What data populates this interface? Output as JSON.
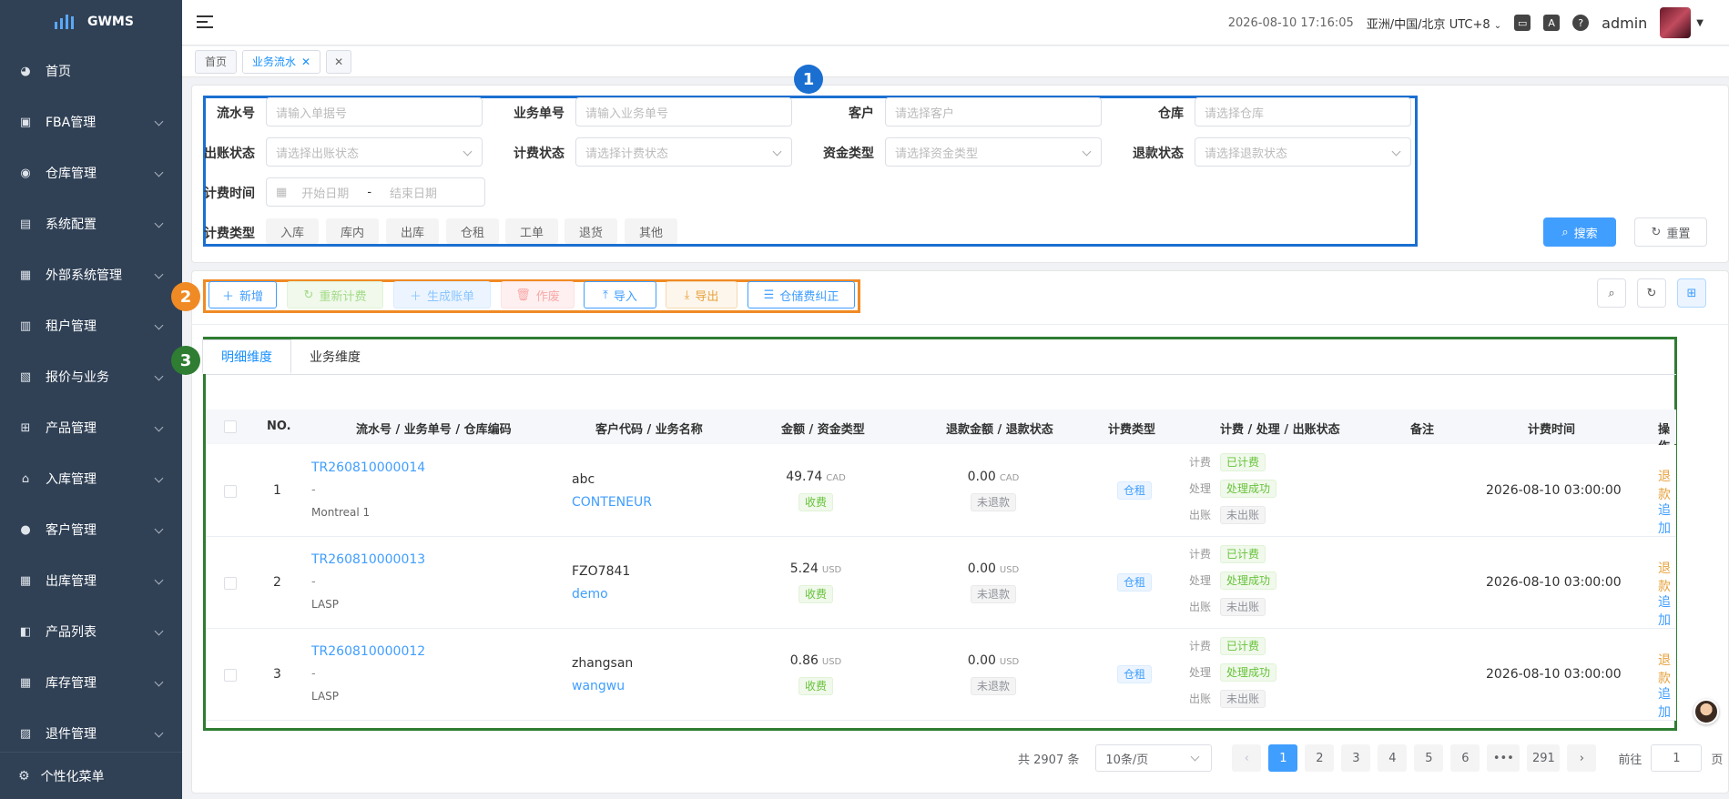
{
  "app": {
    "name": "GWMS"
  },
  "sidebar": {
    "items": [
      {
        "label": "首页",
        "icon": "dashboard-icon",
        "glyph": "◕",
        "expandable": false
      },
      {
        "label": "FBA管理",
        "icon": "fba-icon",
        "glyph": "▣",
        "expandable": true
      },
      {
        "label": "仓库管理",
        "icon": "globe-icon",
        "glyph": "◉",
        "expandable": true
      },
      {
        "label": "系统配置",
        "icon": "config-icon",
        "glyph": "▤",
        "expandable": true
      },
      {
        "label": "外部系统管理",
        "icon": "grid-icon",
        "glyph": "▦",
        "expandable": true
      },
      {
        "label": "租户管理",
        "icon": "bar-chart-icon",
        "glyph": "▥",
        "expandable": true
      },
      {
        "label": "报价与业务",
        "icon": "document-icon",
        "glyph": "▧",
        "expandable": true
      },
      {
        "label": "产品管理",
        "icon": "cart-icon",
        "glyph": "⊞",
        "expandable": true
      },
      {
        "label": "入库管理",
        "icon": "home-icon",
        "glyph": "⌂",
        "expandable": true
      },
      {
        "label": "客户管理",
        "icon": "user-icon",
        "glyph": "●",
        "expandable": true
      },
      {
        "label": "出库管理",
        "icon": "grid-icon",
        "glyph": "▦",
        "expandable": true
      },
      {
        "label": "产品列表",
        "icon": "book-icon",
        "glyph": "◧",
        "expandable": true
      },
      {
        "label": "库存管理",
        "icon": "table-icon",
        "glyph": "▦",
        "expandable": true
      },
      {
        "label": "退件管理",
        "icon": "return-icon",
        "glyph": "▨",
        "expandable": true
      }
    ],
    "bottom": {
      "label": "个性化菜单",
      "icon": "gear-icon",
      "glyph": "⚙"
    }
  },
  "header": {
    "datetime": "2026-08-10 17:16:05",
    "timezone": "亚洲/中国/北京 UTC+8",
    "user": "admin"
  },
  "tabs": [
    {
      "label": "首页",
      "active": false
    },
    {
      "label": "业务流水",
      "active": true
    }
  ],
  "filters": {
    "row1": [
      {
        "label": "流水号",
        "placeholder": "请输入单据号"
      },
      {
        "label": "业务单号",
        "placeholder": "请输入业务单号"
      },
      {
        "label": "客户",
        "placeholder": "请选择客户"
      },
      {
        "label": "仓库",
        "placeholder": "请选择仓库"
      }
    ],
    "row2": [
      {
        "label": "出账状态",
        "placeholder": "请选择出账状态"
      },
      {
        "label": "计费状态",
        "placeholder": "请选择计费状态"
      },
      {
        "label": "资金类型",
        "placeholder": "请选择资金类型"
      },
      {
        "label": "退款状态",
        "placeholder": "请选择退款状态"
      }
    ],
    "billing_time": {
      "label": "计费时间",
      "start": "开始日期",
      "sep": "-",
      "end": "结束日期"
    },
    "billing_type": {
      "label": "计费类型",
      "options": [
        "入库",
        "库内",
        "出库",
        "仓租",
        "工单",
        "退货",
        "其他"
      ]
    },
    "search_label": "搜索",
    "reset_label": "重置"
  },
  "toolbar": {
    "add": "新增",
    "recalc": "重新计费",
    "gen_bill": "生成账单",
    "void": "作废",
    "import": "导入",
    "export": "导出",
    "storage_fix": "仓储费纠正"
  },
  "badges": [
    "1",
    "2",
    "3"
  ],
  "dimension_tabs": [
    {
      "label": "明细维度",
      "active": true
    },
    {
      "label": "业务维度",
      "active": false
    }
  ],
  "table": {
    "columns": [
      "NO.",
      "流水号 / 业务单号 / 仓库编码",
      "客户代码 / 业务名称",
      "金额 / 资金类型",
      "退款金额 / 退款状态",
      "计费类型",
      "计费 / 处理 / 出账状态",
      "备注",
      "计费时间",
      "操作"
    ],
    "rows": [
      {
        "no": "1",
        "flow_no": "TR260810000014",
        "biz_no": "-",
        "warehouse": "Montreal 1",
        "customer": "abc",
        "biz_name": "CONTENEUR",
        "amount": "49.74",
        "currency": "CAD",
        "fund_type": "收费",
        "refund": "0.00",
        "refund_currency": "CAD",
        "refund_status": "未退款",
        "billing_type": "仓租",
        "status_labels": [
          "计费",
          "处理",
          "出账"
        ],
        "statuses": [
          "已计费",
          "处理成功",
          "未出账"
        ],
        "time": "2026-08-10 03:00:00",
        "actions": [
          "退款",
          "追加"
        ]
      },
      {
        "no": "2",
        "flow_no": "TR260810000013",
        "biz_no": "-",
        "warehouse": "LASP",
        "customer": "FZO7841",
        "biz_name": "demo",
        "amount": "5.24",
        "currency": "USD",
        "fund_type": "收费",
        "refund": "0.00",
        "refund_currency": "USD",
        "refund_status": "未退款",
        "billing_type": "仓租",
        "status_labels": [
          "计费",
          "处理",
          "出账"
        ],
        "statuses": [
          "已计费",
          "处理成功",
          "未出账"
        ],
        "time": "2026-08-10 03:00:00",
        "actions": [
          "退款",
          "追加"
        ]
      },
      {
        "no": "3",
        "flow_no": "TR260810000012",
        "biz_no": "-",
        "warehouse": "LASP",
        "customer": "zhangsan",
        "biz_name": "wangwu",
        "amount": "0.86",
        "currency": "USD",
        "fund_type": "收费",
        "refund": "0.00",
        "refund_currency": "USD",
        "refund_status": "未退款",
        "billing_type": "仓租",
        "status_labels": [
          "计费",
          "处理",
          "出账"
        ],
        "statuses": [
          "已计费",
          "处理成功",
          "未出账"
        ],
        "time": "2026-08-10 03:00:00",
        "actions": [
          "退款",
          "追加"
        ]
      }
    ]
  },
  "pagination": {
    "total": "共 2907 条",
    "page_size": "10条/页",
    "pages": [
      "1",
      "2",
      "3",
      "4",
      "5",
      "6",
      "•••",
      "291"
    ],
    "current": "1",
    "goto_label": "前往",
    "goto_value": "1",
    "page_suffix": "页"
  },
  "colors": {
    "accent": "#409eff",
    "box1": "#1a6fd1",
    "box2": "#f08a24",
    "box3": "#2e7d32"
  }
}
